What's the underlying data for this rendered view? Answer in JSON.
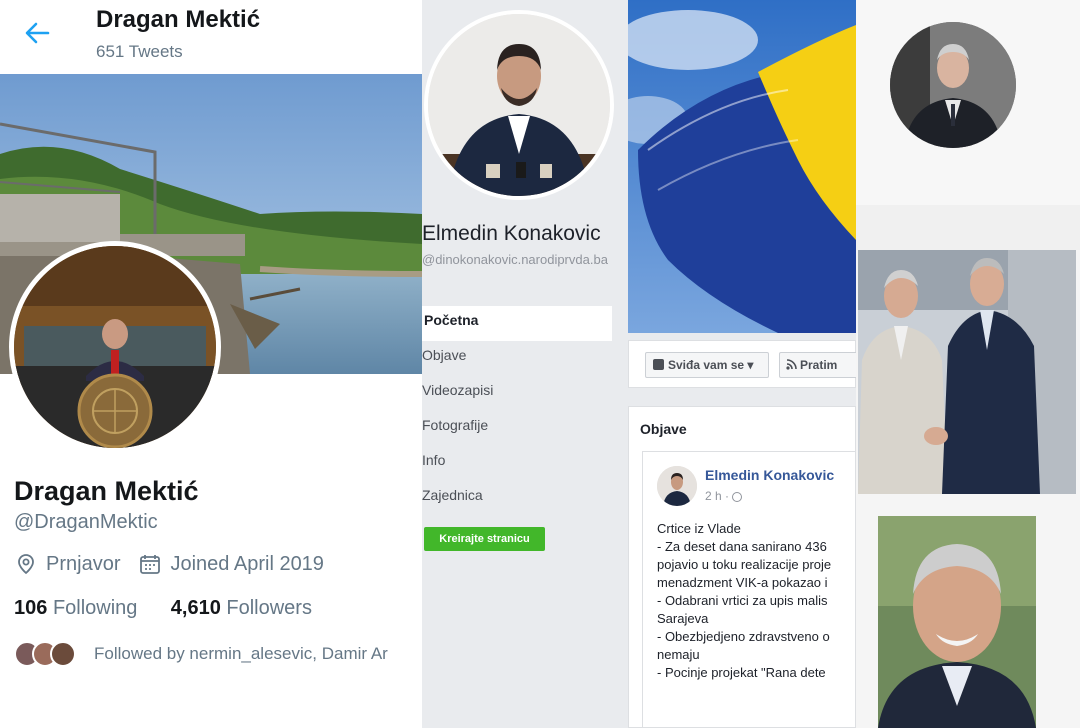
{
  "twitter": {
    "header_name": "Dragan Mektić",
    "tweet_count": "651 Tweets",
    "display_name": "Dragan Mektić",
    "handle": "@DraganMektic",
    "location": "Prnjavor",
    "joined": "Joined April 2019",
    "following_count": "106",
    "following_label": "Following",
    "followers_count": "4,610",
    "followers_label": "Followers",
    "followed_by": "Followed by nermin_alesevic, Damir Ar",
    "accent_color": "#1da1f2",
    "icons": [
      "back-arrow-icon",
      "location-pin-icon",
      "calendar-icon"
    ]
  },
  "facebook": {
    "page_name": "Elmedin Konakovic",
    "username": "@dinokonakovic.narodiprvda.ba",
    "nav": [
      {
        "label": "Početna",
        "active": true
      },
      {
        "label": "Objave",
        "active": false
      },
      {
        "label": "Videozapisi",
        "active": false
      },
      {
        "label": "Fotografije",
        "active": false
      },
      {
        "label": "Info",
        "active": false
      },
      {
        "label": "Zajednica",
        "active": false
      }
    ],
    "create_page_label": "Kreirajte stranicu",
    "like_button_label": "Sviđa vam se ▾",
    "follow_button_label": "Pratim",
    "posts_title": "Objave",
    "post": {
      "author": "Elmedin Konakovic",
      "time": "2 h · ",
      "lines": [
        "Crtice iz Vlade",
        "- Za deset dana sanirano 436",
        "pojavio u toku realizacije proje",
        "menadzment VIK-a pokazao i",
        "- Odabrani vrtici za upis malis",
        "Sarajeva",
        "- Obezbjedjeno zdravstveno o",
        "nemaju",
        "- Pocinje projekat \"Rana dete"
      ]
    },
    "create_color": "#42b72a",
    "link_color": "#365899"
  }
}
